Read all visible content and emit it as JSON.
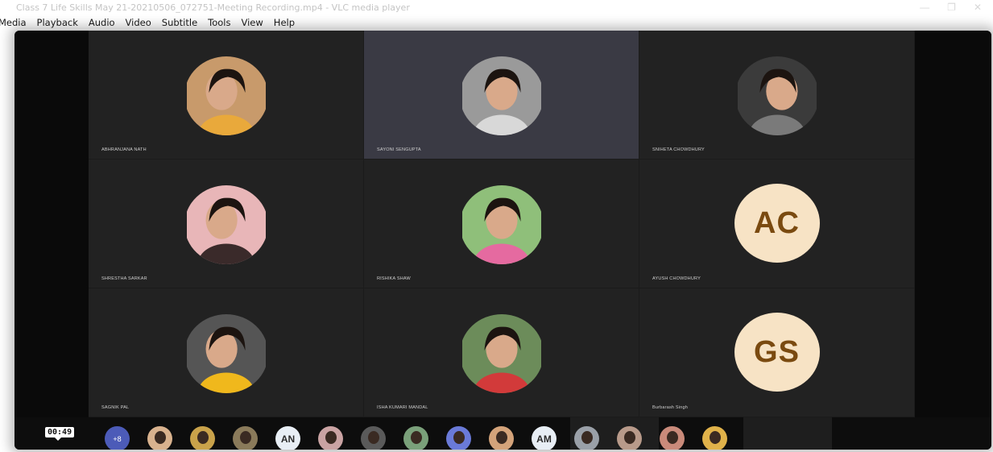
{
  "window": {
    "title": "Class 7 Life Skills May 21-20210506_072751-Meeting Recording.mp4 - VLC media player",
    "controls": [
      "—",
      "❐",
      "✕"
    ]
  },
  "menu": [
    "Media",
    "Playback",
    "Audio",
    "Video",
    "Subtitle",
    "Tools",
    "View",
    "Help"
  ],
  "participants": [
    {
      "name": "ABHRANJANA NATH",
      "type": "photo",
      "bg": "#c89a6b",
      "fg": "#e9a93b"
    },
    {
      "name": "SAYONI SENGUPTA",
      "type": "photo",
      "bg": "#9a9a9a",
      "fg": "#d8d8d8",
      "active": true
    },
    {
      "name": "SNIHETA CHOWDHURY",
      "type": "photo",
      "bg": "#3b3b3b",
      "fg": "#7a7a7a"
    },
    {
      "name": "SHRESTHA SARKAR",
      "type": "photo",
      "bg": "#e8b6b8",
      "fg": "#3a2a2a"
    },
    {
      "name": "RISHIKA SHAW",
      "type": "photo",
      "bg": "#8fbf7a",
      "fg": "#e56aa0"
    },
    {
      "name": "AYUSH CHOWDHURY",
      "type": "initials",
      "initials": "AC"
    },
    {
      "name": "SAGNIK PAL",
      "type": "photo",
      "bg": "#555555",
      "fg": "#f0b81c"
    },
    {
      "name": "ISHA KUMARI MANDAL",
      "type": "photo",
      "bg": "#6c8c5a",
      "fg": "#d23a3a"
    },
    {
      "name": "Burbarash Singh",
      "type": "initials",
      "initials": "GS"
    }
  ],
  "bottom": {
    "timer": "00:49",
    "more": "+8",
    "strip": [
      {
        "type": "photo",
        "color": "#d9b28e"
      },
      {
        "type": "photo",
        "color": "#c9a24a"
      },
      {
        "type": "photo",
        "color": "#8a7a5a"
      },
      {
        "type": "initials",
        "text": "AN"
      },
      {
        "type": "photo",
        "color": "#caa3a3"
      },
      {
        "type": "photo",
        "color": "#5a5a5a"
      },
      {
        "type": "photo",
        "color": "#7aa07a"
      },
      {
        "type": "photo",
        "color": "#6a7ad8"
      },
      {
        "type": "photo",
        "color": "#d4a37a"
      },
      {
        "type": "initials",
        "text": "AM"
      },
      {
        "type": "photo",
        "color": "#9aa0a8"
      },
      {
        "type": "photo",
        "color": "#b89a8a"
      },
      {
        "type": "photo",
        "color": "#c98a7a"
      },
      {
        "type": "photo",
        "color": "#e0b24a"
      }
    ]
  }
}
